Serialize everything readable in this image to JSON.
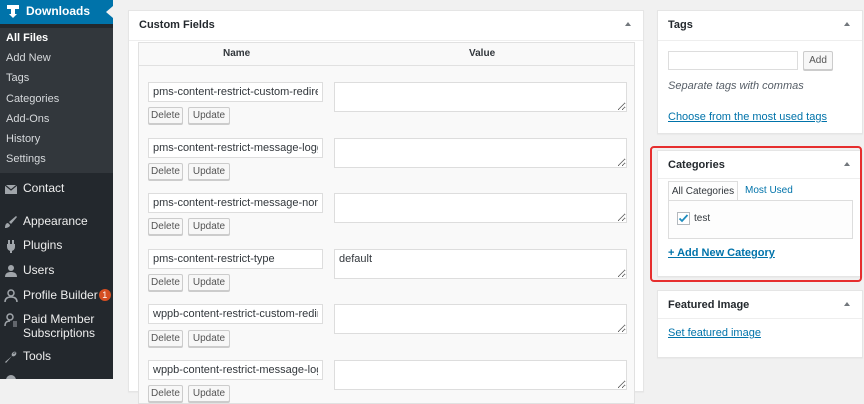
{
  "sidebar": {
    "current_menu": {
      "label": "Downloads",
      "icon": "download-icon"
    },
    "submenu": [
      {
        "label": "All Files",
        "current": true
      },
      {
        "label": "Add New",
        "current": false
      },
      {
        "label": "Tags",
        "current": false
      },
      {
        "label": "Categories",
        "current": false
      },
      {
        "label": "Add-Ons",
        "current": false
      },
      {
        "label": "History",
        "current": false
      },
      {
        "label": "Settings",
        "current": false
      }
    ],
    "items": [
      {
        "label": "Contact",
        "icon": "mail-icon"
      },
      {
        "label": "Appearance",
        "icon": "paintbrush-icon"
      },
      {
        "label": "Plugins",
        "icon": "plugin-icon"
      },
      {
        "label": "Users",
        "icon": "users-icon"
      },
      {
        "label": "Profile Builder",
        "icon": "profile-icon",
        "badge": "1"
      },
      {
        "label": "Paid Member Subscriptions",
        "icon": "member-icon"
      },
      {
        "label": "Tools",
        "icon": "wrench-icon"
      }
    ]
  },
  "custom_fields": {
    "title": "Custom Fields",
    "col_name": "Name",
    "col_value": "Value",
    "delete_label": "Delete",
    "update_label": "Update",
    "rows": [
      {
        "name": "pms-content-restrict-custom-redirect-url",
        "value": ""
      },
      {
        "name": "pms-content-restrict-message-logged_out",
        "value": ""
      },
      {
        "name": "pms-content-restrict-message-non_members",
        "value": ""
      },
      {
        "name": "pms-content-restrict-type",
        "value": "default"
      },
      {
        "name": "wppb-content-restrict-custom-redirect-url",
        "value": ""
      },
      {
        "name": "wppb-content-restrict-message-logged_out",
        "value": ""
      }
    ]
  },
  "tags_box": {
    "title": "Tags",
    "input_value": "",
    "add_label": "Add",
    "hint": "Separate tags with commas",
    "choose_link": "Choose from the most used tags"
  },
  "categories_box": {
    "title": "Categories",
    "tab_all": "All Categories",
    "tab_most_used": "Most Used",
    "items": [
      {
        "label": "test",
        "checked": true
      }
    ],
    "add_new_link": "+ Add New Category",
    "highlight_color": "#e62e2e"
  },
  "featured_box": {
    "title": "Featured Image",
    "set_link": "Set featured image"
  },
  "colors": {
    "sidebar_bg": "#23282d",
    "submenu_bg": "#32373c",
    "accent": "#0073aa",
    "badge": "#d54e21"
  }
}
